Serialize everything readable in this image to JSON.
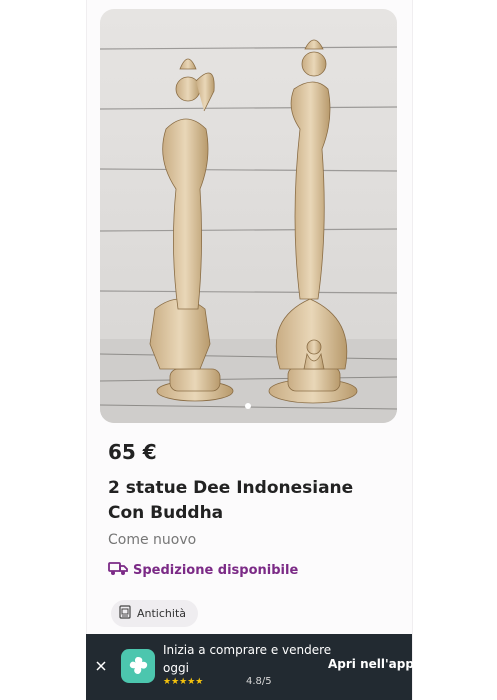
{
  "listing": {
    "photo_alt": "2 statue Dee Indonesiane Con Buddha",
    "carousel_dots": 1,
    "price": "65 €",
    "title": "2 statue Dee Indonesiane Con Buddha",
    "condition": "Come nuovo",
    "shipping_label": "Spedizione disponibile",
    "category_chip": "Antichità"
  },
  "app_banner": {
    "promo_text": "Inizia a comprare e vendere oggi",
    "rating": "4.8/5",
    "stars_icon": "rating-stars-icon",
    "open_label": "Apri nell'app"
  },
  "colors": {
    "accent": "#7b2a86",
    "banner_bg": "#222a31",
    "app_icon": "#4cc6ae",
    "stars": "#f4c20d"
  }
}
